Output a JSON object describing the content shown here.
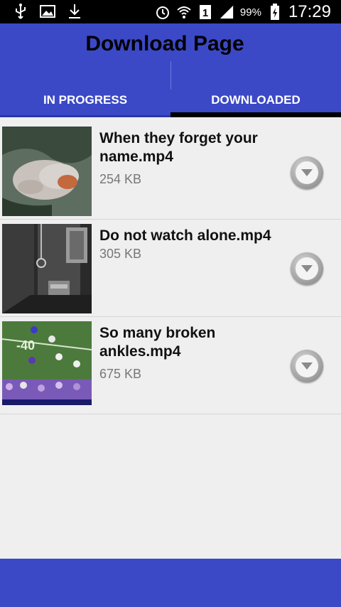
{
  "status_bar": {
    "icons_left": [
      "usb-icon",
      "image-icon",
      "download-icon"
    ],
    "icons_right": [
      "alarm-icon",
      "wifi-icon",
      "sim-icon",
      "signal-icon"
    ],
    "battery_percent": "99%",
    "time": "17:29"
  },
  "header": {
    "title": "Download Page"
  },
  "tabs": [
    {
      "label": "IN PROGRESS",
      "active": false
    },
    {
      "label": "DOWNLOADED",
      "active": true
    }
  ],
  "items": [
    {
      "title": "When they forget your name.mp4",
      "size": "254 KB",
      "thumb": "blanket-thumbnail"
    },
    {
      "title": "Do not watch alone.mp4",
      "size": "305 KB",
      "thumb": "dark-room-thumbnail"
    },
    {
      "title": "So many broken ankles.mp4",
      "size": "675 KB",
      "thumb": "football-field-thumbnail"
    }
  ],
  "colors": {
    "primary": "#3b49c7",
    "status_bar": "#000000",
    "background": "#efefef"
  }
}
